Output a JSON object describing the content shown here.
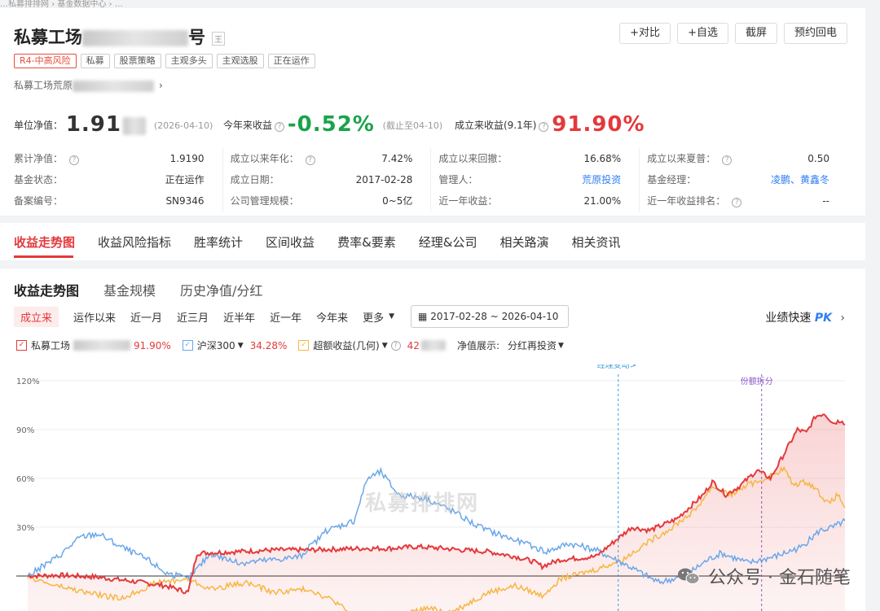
{
  "breadcrumb": "…私募排排网 › 基金数据中心 › …",
  "fund": {
    "title_prefix": "私募工场",
    "title_suffix": "号",
    "badge": "王",
    "tags": [
      "R4-中高风险",
      "私募",
      "股票策略",
      "主观多头",
      "主观选股",
      "正在运作"
    ],
    "company": "私募工场荒原"
  },
  "actions": [
    "+对比",
    "+自选",
    "截屏",
    "预约回电"
  ],
  "metrics": {
    "nav_label": "单位净值：",
    "nav_value": "1.91",
    "nav_date": "(2026-04-10)",
    "ytd_label": "今年来收益",
    "ytd_value": "-0.52%",
    "ytd_note": "(截止至04-10)",
    "since_label": "成立来收益(9.1年)",
    "since_value": "91.90%"
  },
  "info_rows": [
    [
      {
        "label": "累计净值：",
        "value": "1.9190"
      },
      {
        "label": "成立以来年化：",
        "value": "7.42%",
        "color": "red"
      },
      {
        "label": "成立以来回撤：",
        "value": "16.68%"
      },
      {
        "label": "成立以来夏普：",
        "value": "0.50"
      }
    ],
    [
      {
        "label": "基金状态：",
        "value": "正在运作"
      },
      {
        "label": "成立日期：",
        "value": "2017-02-28"
      },
      {
        "label": "管理人：",
        "value": "荒原投资",
        "color": "link"
      },
      {
        "label": "基金经理：",
        "value": "凌鹏、黄鑫冬",
        "color": "link"
      }
    ],
    [
      {
        "label": "备案编号：",
        "value": "SN9346"
      },
      {
        "label": "公司管理规模：",
        "value": "0~5亿"
      },
      {
        "label": "近一年收益：",
        "value": "21.00%",
        "color": "red"
      },
      {
        "label": "近一年收益排名：",
        "value": "--"
      }
    ]
  ],
  "tabs": [
    "收益走势图",
    "收益风险指标",
    "胜率统计",
    "区间收益",
    "费率&要素",
    "经理&公司",
    "相关路演",
    "相关资讯"
  ],
  "sub_tabs": [
    "收益走势图",
    "基金规模",
    "历史净值/分红"
  ],
  "ranges": [
    "成立来",
    "运作以来",
    "近一月",
    "近三月",
    "近半年",
    "近一年",
    "今年来",
    "更多"
  ],
  "date_range": "2017-02-28 ~ 2026-04-10",
  "pk_label": "业绩快速",
  "pk_word": "PK",
  "legend": {
    "fund_name": "私募工场",
    "fund_value": "91.90%",
    "index_name": "沪深300",
    "index_value": "34.28%",
    "excess_name": "超额收益(几何)",
    "excess_value": "42",
    "nav_display_label": "净值展示:",
    "nav_display_value": "分红再投资"
  },
  "watermark": "私募排排网",
  "wechat_text": "公众号 · 金石随笔",
  "colors": {
    "fund": "#e4393c",
    "index": "#6aa7ea",
    "excess": "#f6b642",
    "accent": "#e4393c"
  },
  "chart_data": {
    "type": "line",
    "y_ticks": [
      "120%",
      "90%",
      "60%",
      "30%"
    ],
    "ylim": [
      -20,
      122
    ],
    "x_range": [
      "2017-02-28",
      "2026-04-10"
    ],
    "annotations": [
      {
        "text": "经理变动>",
        "date": "2023-10"
      },
      {
        "text": "份额拆分",
        "date": "2025-04"
      }
    ],
    "series": [
      {
        "name": "私募工场",
        "color": "#e4393c",
        "values": [
          [
            2017.16,
            0
          ],
          [
            2017.5,
            0.5
          ],
          [
            2017.9,
            -0.5
          ],
          [
            2018.3,
            -3
          ],
          [
            2018.7,
            -6
          ],
          [
            2018.95,
            -10
          ],
          [
            2019.05,
            14
          ],
          [
            2019.5,
            15
          ],
          [
            2019.9,
            16
          ],
          [
            2020.3,
            16
          ],
          [
            2020.6,
            16.5
          ],
          [
            2020.9,
            17
          ],
          [
            2021.2,
            17
          ],
          [
            2021.5,
            18
          ],
          [
            2021.8,
            17
          ],
          [
            2022.0,
            16
          ],
          [
            2022.3,
            15
          ],
          [
            2022.6,
            12
          ],
          [
            2022.8,
            9
          ],
          [
            2022.9,
            6
          ],
          [
            2023.1,
            10
          ],
          [
            2023.5,
            12
          ],
          [
            2023.9,
            30
          ],
          [
            2024.1,
            28
          ],
          [
            2024.4,
            35
          ],
          [
            2024.7,
            50
          ],
          [
            2024.8,
            58
          ],
          [
            2024.95,
            50
          ],
          [
            2025.1,
            55
          ],
          [
            2025.3,
            65
          ],
          [
            2025.45,
            60
          ],
          [
            2025.6,
            75
          ],
          [
            2025.75,
            90
          ],
          [
            2025.85,
            88
          ],
          [
            2025.95,
            98
          ],
          [
            2026.05,
            100
          ],
          [
            2026.15,
            94
          ],
          [
            2026.25,
            96
          ],
          [
            2026.28,
            93
          ]
        ]
      },
      {
        "name": "沪深300",
        "color": "#6aa7ea",
        "values": [
          [
            2017.16,
            0
          ],
          [
            2017.5,
            12
          ],
          [
            2017.75,
            24
          ],
          [
            2017.95,
            26
          ],
          [
            2018.2,
            18
          ],
          [
            2018.5,
            10
          ],
          [
            2018.7,
            2
          ],
          [
            2018.95,
            -2
          ],
          [
            2019.2,
            14
          ],
          [
            2019.5,
            8
          ],
          [
            2019.9,
            10
          ],
          [
            2020.2,
            12
          ],
          [
            2020.5,
            28
          ],
          [
            2020.8,
            34
          ],
          [
            2020.95,
            60
          ],
          [
            2021.1,
            64
          ],
          [
            2021.3,
            50
          ],
          [
            2021.6,
            48
          ],
          [
            2021.9,
            40
          ],
          [
            2022.2,
            30
          ],
          [
            2022.5,
            24
          ],
          [
            2022.8,
            18
          ],
          [
            2022.95,
            15
          ],
          [
            2023.2,
            20
          ],
          [
            2023.5,
            16
          ],
          [
            2023.8,
            8
          ],
          [
            2024.0,
            2
          ],
          [
            2024.2,
            -4
          ],
          [
            2024.5,
            0
          ],
          [
            2024.75,
            10
          ],
          [
            2024.9,
            14
          ],
          [
            2025.2,
            8
          ],
          [
            2025.5,
            12
          ],
          [
            2025.8,
            18
          ],
          [
            2026.0,
            28
          ],
          [
            2026.15,
            30
          ],
          [
            2026.28,
            34
          ]
        ]
      },
      {
        "name": "超额收益(几何)",
        "color": "#f6b642",
        "values": [
          [
            2017.16,
            0
          ],
          [
            2017.4,
            -5
          ],
          [
            2017.8,
            -10
          ],
          [
            2018.2,
            -14
          ],
          [
            2018.6,
            -4
          ],
          [
            2018.95,
            -2
          ],
          [
            2019.2,
            -8
          ],
          [
            2019.6,
            -4
          ],
          [
            2019.9,
            -10
          ],
          [
            2020.3,
            -8
          ],
          [
            2020.6,
            -16
          ],
          [
            2020.9,
            -30
          ],
          [
            2021.2,
            -26
          ],
          [
            2021.6,
            -20
          ],
          [
            2021.9,
            -22
          ],
          [
            2022.3,
            -10
          ],
          [
            2022.6,
            -6
          ],
          [
            2022.9,
            -12
          ],
          [
            2023.1,
            -2
          ],
          [
            2023.5,
            4
          ],
          [
            2023.8,
            10
          ],
          [
            2024.0,
            18
          ],
          [
            2024.3,
            28
          ],
          [
            2024.6,
            40
          ],
          [
            2024.8,
            55
          ],
          [
            2025.0,
            50
          ],
          [
            2025.2,
            56
          ],
          [
            2025.4,
            60
          ],
          [
            2025.6,
            66
          ],
          [
            2025.7,
            56
          ],
          [
            2025.85,
            58
          ],
          [
            2025.95,
            54
          ],
          [
            2026.1,
            44
          ],
          [
            2026.2,
            50
          ],
          [
            2026.28,
            42
          ]
        ]
      }
    ]
  }
}
